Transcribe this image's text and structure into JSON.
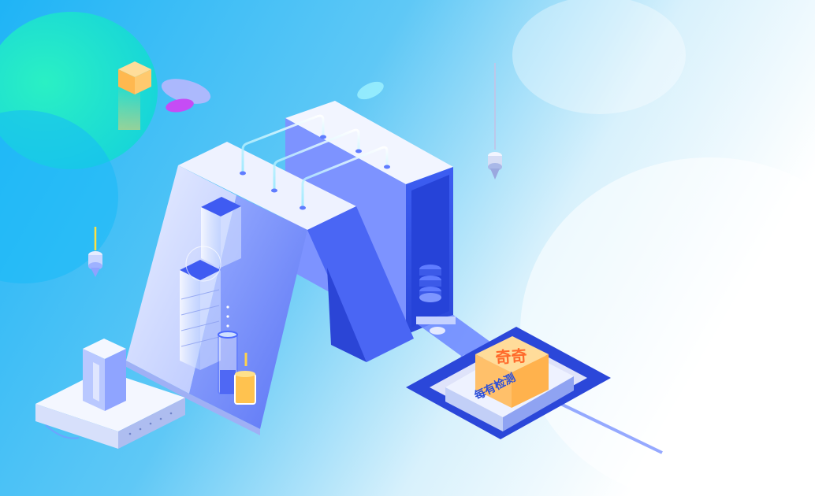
{
  "box": {
    "top_text": "奇奇",
    "plate_text": "每有检测"
  },
  "colors": {
    "teal_blob": "#22e2c9",
    "sky_blue": "#3aa8f5",
    "building_light": "#cfd9ff",
    "building_mid": "#8fa2ff",
    "building_dark": "#3f5bf2",
    "box_orange": "#ffc06a",
    "box_text": "#ff6a2b",
    "plate_text": "#2d4fd6",
    "cube_yellow": "#ffc46b",
    "pill_purple": "#b85cff"
  },
  "icons": [
    "floating-cube-icon",
    "floating-pill-icon",
    "hanging-sensor-icon",
    "tube-pipes-icon",
    "cylinder-beaker-icon",
    "stacked-disks-icon",
    "inspection-box-icon"
  ]
}
